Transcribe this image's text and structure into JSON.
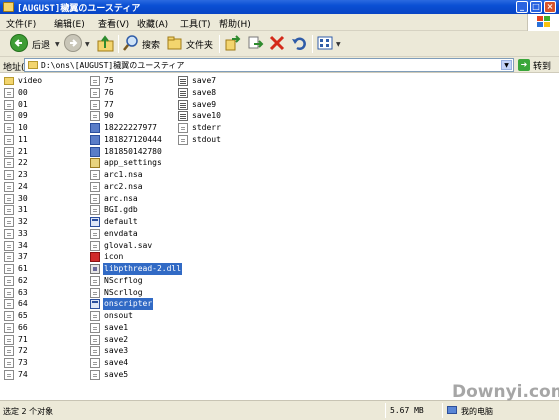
{
  "window": {
    "title": "[AUGUST]穢翼のユースティア",
    "colors": {
      "titlebar": "#0a4fd4",
      "chrome": "#ece9d8",
      "selection": "#316ac5"
    }
  },
  "menu": {
    "items": [
      "文件(F)",
      "编辑(E)",
      "查看(V)",
      "收藏(A)",
      "工具(T)",
      "帮助(H)"
    ]
  },
  "toolbar": {
    "back_label": "后退",
    "search_label": "搜索",
    "folders_label": "文件夹",
    "icons": [
      "back-arrow-icon",
      "forward-arrow-icon",
      "up-folder-icon",
      "search-icon",
      "folders-icon",
      "move-to-icon",
      "copy-to-icon",
      "delete-icon",
      "undo-icon",
      "views-icon"
    ]
  },
  "address": {
    "label": "地址(D)",
    "value": "D:\\ons\\[AUGUST]穢翼のユースティア",
    "go_label": "转到"
  },
  "files": {
    "col1": [
      {
        "name": "video",
        "type": "folder"
      },
      {
        "name": "00",
        "type": "file"
      },
      {
        "name": "01",
        "type": "file"
      },
      {
        "name": "09",
        "type": "file"
      },
      {
        "name": "10",
        "type": "file"
      },
      {
        "name": "11",
        "type": "file"
      },
      {
        "name": "21",
        "type": "file"
      },
      {
        "name": "22",
        "type": "file"
      },
      {
        "name": "23",
        "type": "file"
      },
      {
        "name": "24",
        "type": "file"
      },
      {
        "name": "30",
        "type": "file"
      },
      {
        "name": "31",
        "type": "file"
      },
      {
        "name": "32",
        "type": "file"
      },
      {
        "name": "33",
        "type": "file"
      },
      {
        "name": "34",
        "type": "file"
      },
      {
        "name": "37",
        "type": "file"
      },
      {
        "name": "61",
        "type": "file"
      },
      {
        "name": "62",
        "type": "file"
      },
      {
        "name": "63",
        "type": "file"
      },
      {
        "name": "64",
        "type": "file"
      },
      {
        "name": "65",
        "type": "file"
      },
      {
        "name": "66",
        "type": "file"
      },
      {
        "name": "71",
        "type": "file"
      },
      {
        "name": "72",
        "type": "file"
      },
      {
        "name": "73",
        "type": "file"
      },
      {
        "name": "74",
        "type": "file"
      }
    ],
    "col2": [
      {
        "name": "75",
        "type": "file"
      },
      {
        "name": "76",
        "type": "file"
      },
      {
        "name": "77",
        "type": "file"
      },
      {
        "name": "90",
        "type": "file"
      },
      {
        "name": "18222227977",
        "type": "image"
      },
      {
        "name": "181827120444",
        "type": "image"
      },
      {
        "name": "181850142780",
        "type": "image"
      },
      {
        "name": "app_settings",
        "type": "settings"
      },
      {
        "name": "arc1.nsa",
        "type": "file"
      },
      {
        "name": "arc2.nsa",
        "type": "file"
      },
      {
        "name": "arc.nsa",
        "type": "file"
      },
      {
        "name": "BGI.gdb",
        "type": "file"
      },
      {
        "name": "default",
        "type": "exe"
      },
      {
        "name": "envdata",
        "type": "file"
      },
      {
        "name": "gloval.sav",
        "type": "file"
      },
      {
        "name": "icon",
        "type": "appicon"
      },
      {
        "name": "libpthread-2.dll",
        "type": "dll",
        "selected": true
      },
      {
        "name": "NScrflog",
        "type": "file"
      },
      {
        "name": "NScrllog",
        "type": "file"
      },
      {
        "name": "onscripter",
        "type": "exe",
        "selected": true
      },
      {
        "name": "onsout",
        "type": "file"
      },
      {
        "name": "save1",
        "type": "file"
      },
      {
        "name": "save2",
        "type": "file"
      },
      {
        "name": "save3",
        "type": "file"
      },
      {
        "name": "save4",
        "type": "file"
      },
      {
        "name": "save5",
        "type": "file"
      }
    ],
    "col3": [
      {
        "name": "save7",
        "type": "txt"
      },
      {
        "name": "save8",
        "type": "txt"
      },
      {
        "name": "save9",
        "type": "txt"
      },
      {
        "name": "save10",
        "type": "txt"
      },
      {
        "name": "stderr",
        "type": "file"
      },
      {
        "name": "stdout",
        "type": "file"
      }
    ]
  },
  "status": {
    "selection_text": "选定 2 个对象",
    "size": "5.67 MB",
    "location": "我的电脑"
  },
  "watermark": "Downyi.com"
}
